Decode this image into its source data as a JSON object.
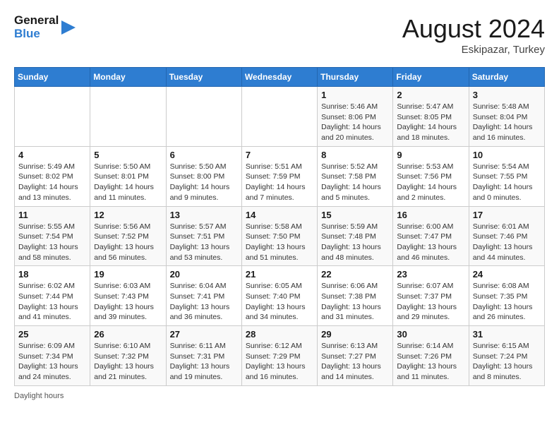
{
  "header": {
    "logo_general": "General",
    "logo_blue": "Blue",
    "month_title": "August 2024",
    "location": "Eskipazar, Turkey"
  },
  "days_of_week": [
    "Sunday",
    "Monday",
    "Tuesday",
    "Wednesday",
    "Thursday",
    "Friday",
    "Saturday"
  ],
  "weeks": [
    [
      {
        "day": "",
        "info": ""
      },
      {
        "day": "",
        "info": ""
      },
      {
        "day": "",
        "info": ""
      },
      {
        "day": "",
        "info": ""
      },
      {
        "day": "1",
        "info": "Sunrise: 5:46 AM\nSunset: 8:06 PM\nDaylight: 14 hours and 20 minutes."
      },
      {
        "day": "2",
        "info": "Sunrise: 5:47 AM\nSunset: 8:05 PM\nDaylight: 14 hours and 18 minutes."
      },
      {
        "day": "3",
        "info": "Sunrise: 5:48 AM\nSunset: 8:04 PM\nDaylight: 14 hours and 16 minutes."
      }
    ],
    [
      {
        "day": "4",
        "info": "Sunrise: 5:49 AM\nSunset: 8:02 PM\nDaylight: 14 hours and 13 minutes."
      },
      {
        "day": "5",
        "info": "Sunrise: 5:50 AM\nSunset: 8:01 PM\nDaylight: 14 hours and 11 minutes."
      },
      {
        "day": "6",
        "info": "Sunrise: 5:50 AM\nSunset: 8:00 PM\nDaylight: 14 hours and 9 minutes."
      },
      {
        "day": "7",
        "info": "Sunrise: 5:51 AM\nSunset: 7:59 PM\nDaylight: 14 hours and 7 minutes."
      },
      {
        "day": "8",
        "info": "Sunrise: 5:52 AM\nSunset: 7:58 PM\nDaylight: 14 hours and 5 minutes."
      },
      {
        "day": "9",
        "info": "Sunrise: 5:53 AM\nSunset: 7:56 PM\nDaylight: 14 hours and 2 minutes."
      },
      {
        "day": "10",
        "info": "Sunrise: 5:54 AM\nSunset: 7:55 PM\nDaylight: 14 hours and 0 minutes."
      }
    ],
    [
      {
        "day": "11",
        "info": "Sunrise: 5:55 AM\nSunset: 7:54 PM\nDaylight: 13 hours and 58 minutes."
      },
      {
        "day": "12",
        "info": "Sunrise: 5:56 AM\nSunset: 7:52 PM\nDaylight: 13 hours and 56 minutes."
      },
      {
        "day": "13",
        "info": "Sunrise: 5:57 AM\nSunset: 7:51 PM\nDaylight: 13 hours and 53 minutes."
      },
      {
        "day": "14",
        "info": "Sunrise: 5:58 AM\nSunset: 7:50 PM\nDaylight: 13 hours and 51 minutes."
      },
      {
        "day": "15",
        "info": "Sunrise: 5:59 AM\nSunset: 7:48 PM\nDaylight: 13 hours and 48 minutes."
      },
      {
        "day": "16",
        "info": "Sunrise: 6:00 AM\nSunset: 7:47 PM\nDaylight: 13 hours and 46 minutes."
      },
      {
        "day": "17",
        "info": "Sunrise: 6:01 AM\nSunset: 7:46 PM\nDaylight: 13 hours and 44 minutes."
      }
    ],
    [
      {
        "day": "18",
        "info": "Sunrise: 6:02 AM\nSunset: 7:44 PM\nDaylight: 13 hours and 41 minutes."
      },
      {
        "day": "19",
        "info": "Sunrise: 6:03 AM\nSunset: 7:43 PM\nDaylight: 13 hours and 39 minutes."
      },
      {
        "day": "20",
        "info": "Sunrise: 6:04 AM\nSunset: 7:41 PM\nDaylight: 13 hours and 36 minutes."
      },
      {
        "day": "21",
        "info": "Sunrise: 6:05 AM\nSunset: 7:40 PM\nDaylight: 13 hours and 34 minutes."
      },
      {
        "day": "22",
        "info": "Sunrise: 6:06 AM\nSunset: 7:38 PM\nDaylight: 13 hours and 31 minutes."
      },
      {
        "day": "23",
        "info": "Sunrise: 6:07 AM\nSunset: 7:37 PM\nDaylight: 13 hours and 29 minutes."
      },
      {
        "day": "24",
        "info": "Sunrise: 6:08 AM\nSunset: 7:35 PM\nDaylight: 13 hours and 26 minutes."
      }
    ],
    [
      {
        "day": "25",
        "info": "Sunrise: 6:09 AM\nSunset: 7:34 PM\nDaylight: 13 hours and 24 minutes."
      },
      {
        "day": "26",
        "info": "Sunrise: 6:10 AM\nSunset: 7:32 PM\nDaylight: 13 hours and 21 minutes."
      },
      {
        "day": "27",
        "info": "Sunrise: 6:11 AM\nSunset: 7:31 PM\nDaylight: 13 hours and 19 minutes."
      },
      {
        "day": "28",
        "info": "Sunrise: 6:12 AM\nSunset: 7:29 PM\nDaylight: 13 hours and 16 minutes."
      },
      {
        "day": "29",
        "info": "Sunrise: 6:13 AM\nSunset: 7:27 PM\nDaylight: 13 hours and 14 minutes."
      },
      {
        "day": "30",
        "info": "Sunrise: 6:14 AM\nSunset: 7:26 PM\nDaylight: 13 hours and 11 minutes."
      },
      {
        "day": "31",
        "info": "Sunrise: 6:15 AM\nSunset: 7:24 PM\nDaylight: 13 hours and 8 minutes."
      }
    ]
  ],
  "footer": {
    "daylight_label": "Daylight hours"
  }
}
